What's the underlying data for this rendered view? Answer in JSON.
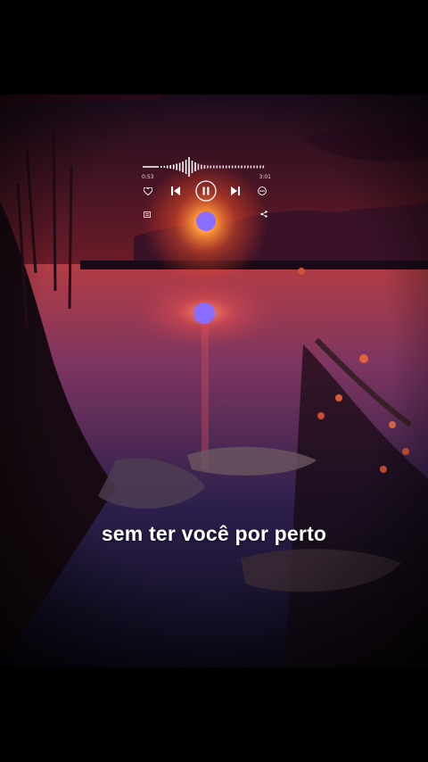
{
  "player": {
    "elapsed": "0:53",
    "duration": "3:01",
    "progress": 0.33,
    "icons": [
      "heart-icon",
      "previous-icon",
      "pause-icon",
      "next-icon",
      "more-icon",
      "playlist-icon",
      "share-icon"
    ]
  },
  "lyrics": {
    "line": "sem ter você por perto"
  },
  "colors": {
    "accent": "#8a6cff",
    "text": "#ffffff"
  }
}
